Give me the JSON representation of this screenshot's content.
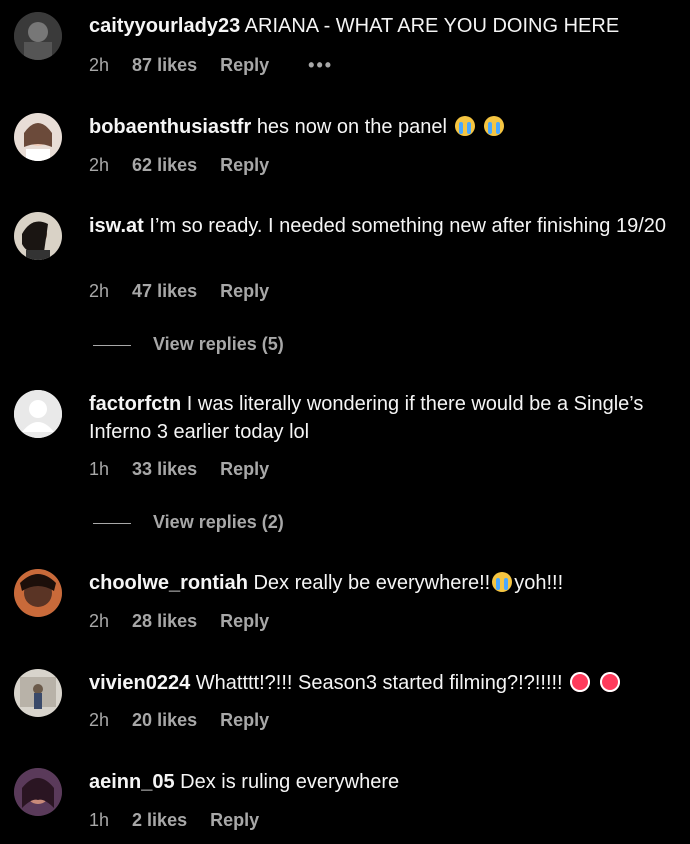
{
  "comments": [
    {
      "username": "caityyourlady23",
      "text": "ARIANA - WHAT ARE YOU DOING HERE",
      "time": "2h",
      "likes": "87 likes",
      "reply": "Reply",
      "more": "•••",
      "emoji": []
    },
    {
      "username": "bobaenthusiastfr",
      "text": "hes now on the panel",
      "time": "2h",
      "likes": "62 likes",
      "reply": "Reply",
      "emoji": [
        "crying-face",
        "crying-face"
      ]
    },
    {
      "username": "isw.at",
      "text": "I’m so ready. I needed something new after finishing 19/20",
      "time": "2h",
      "likes": "47 likes",
      "reply": "Reply",
      "view_replies": "View replies (5)"
    },
    {
      "username": "factorfctn",
      "text": "I was literally wondering if there would be a Single’s Inferno 3 earlier today lol",
      "time": "1h",
      "likes": "33 likes",
      "reply": "Reply",
      "view_replies": "View replies (2)"
    },
    {
      "username": "choolwe_rontiah",
      "text": "Dex really be everywhere!!",
      "text_after": "yoh!!!",
      "time": "2h",
      "likes": "28 likes",
      "reply": "Reply"
    },
    {
      "username": "vivien0224",
      "text": "Whatttt!?!!! Season3 started filming?!?!!!!!",
      "time": "2h",
      "likes": "20 likes",
      "reply": "Reply"
    },
    {
      "username": "aeinn_05",
      "text": "Dex is ruling everywhere",
      "time": "1h",
      "likes": "2 likes",
      "reply": "Reply"
    }
  ],
  "colors": {
    "background": "#000000",
    "text": "#f5f5f5",
    "secondary": "#a8a8a8"
  },
  "icons": {
    "crying": "crying-face-emoji",
    "heart": "heart-emoji",
    "more": "more-options-icon"
  }
}
